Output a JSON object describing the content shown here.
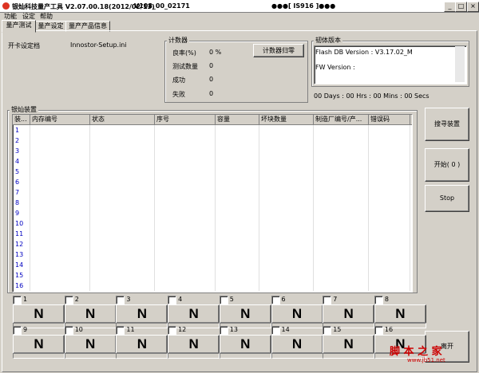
{
  "window": {
    "title": "银灿科技量产工具 V2.07.00.18(2012/02/13)",
    "build": "V108_00_02171",
    "ic": "●●●[ IS916 ]●●●",
    "minimize": "_",
    "maximize": "□",
    "close": "×"
  },
  "menu": [
    "功能",
    "设定",
    "帮助"
  ],
  "tabs": [
    "量产测试",
    "量产设定",
    "量产产品信息"
  ],
  "settings": {
    "label": "开卡设定档",
    "value": "Innostor-Setup.ini"
  },
  "counter": {
    "title": "计数器",
    "labels": [
      "良率(%)",
      "测试数量",
      "成功",
      "失败"
    ],
    "values": [
      "0 %",
      "0",
      "0",
      "0"
    ],
    "reset_button": "计数器归零"
  },
  "firmware": {
    "title": "韧体版本",
    "flash_db": "Flash DB Version :   V3.17.02_M",
    "fw": "FW Version :",
    "timer": "00 Days : 00 Hrs : 00 Mins : 00 Secs"
  },
  "devices": {
    "title": "银灿装置",
    "columns": [
      "装...",
      "内存编号",
      "状态",
      "序号",
      "容量",
      "坏块数量",
      "制造厂编号/产...",
      "错误码"
    ],
    "rows": [
      "1",
      "2",
      "3",
      "4",
      "5",
      "6",
      "7",
      "8",
      "9",
      "10",
      "11",
      "12",
      "13",
      "14",
      "15",
      "16"
    ]
  },
  "buttons": {
    "search": "搜寻装置",
    "start": "开始( 0 )",
    "stop": "Stop",
    "exit": "离开"
  },
  "ports": [
    {
      "num": "1",
      "status": "N"
    },
    {
      "num": "2",
      "status": "N"
    },
    {
      "num": "3",
      "status": "N"
    },
    {
      "num": "4",
      "status": "N"
    },
    {
      "num": "5",
      "status": "N"
    },
    {
      "num": "6",
      "status": "N"
    },
    {
      "num": "7",
      "status": "N"
    },
    {
      "num": "8",
      "status": "N"
    },
    {
      "num": "9",
      "status": "N"
    },
    {
      "num": "10",
      "status": "N"
    },
    {
      "num": "11",
      "status": "N"
    },
    {
      "num": "12",
      "status": "N"
    },
    {
      "num": "13",
      "status": "N"
    },
    {
      "num": "14",
      "status": "N"
    },
    {
      "num": "15",
      "status": "N"
    },
    {
      "num": "16",
      "status": "N"
    }
  ],
  "watermark": {
    "text": "脚 本 之 家",
    "url": "www.jb51.net"
  }
}
